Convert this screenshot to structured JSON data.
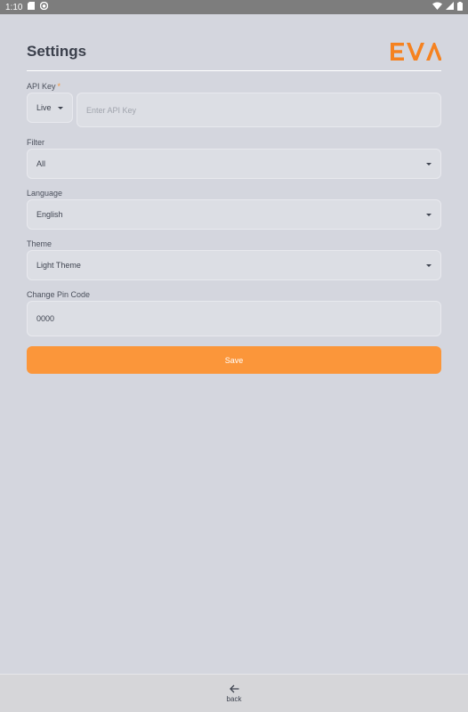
{
  "status_bar": {
    "time": "1:10",
    "icons": [
      "sd-card-icon",
      "notification-icon",
      "wifi-icon",
      "signal-icon",
      "battery-icon"
    ]
  },
  "header": {
    "title": "Settings",
    "logo_text": "EVA",
    "logo_color": "#f58220"
  },
  "api_key": {
    "label": "API Key",
    "required_marker": "*",
    "environment_value": "Live",
    "placeholder": "Enter API Key",
    "value": ""
  },
  "filter": {
    "label": "Filter",
    "value": "All"
  },
  "language": {
    "label": "Language",
    "value": "English"
  },
  "theme": {
    "label": "Theme",
    "value": "Light Theme"
  },
  "pin": {
    "label": "Change Pin Code",
    "value": "0000"
  },
  "save_label": "Save",
  "bottom_nav": {
    "back_label": "back"
  },
  "colors": {
    "background": "#d4d6de",
    "accent": "#fb963a",
    "field_background": "#dcdee4"
  }
}
